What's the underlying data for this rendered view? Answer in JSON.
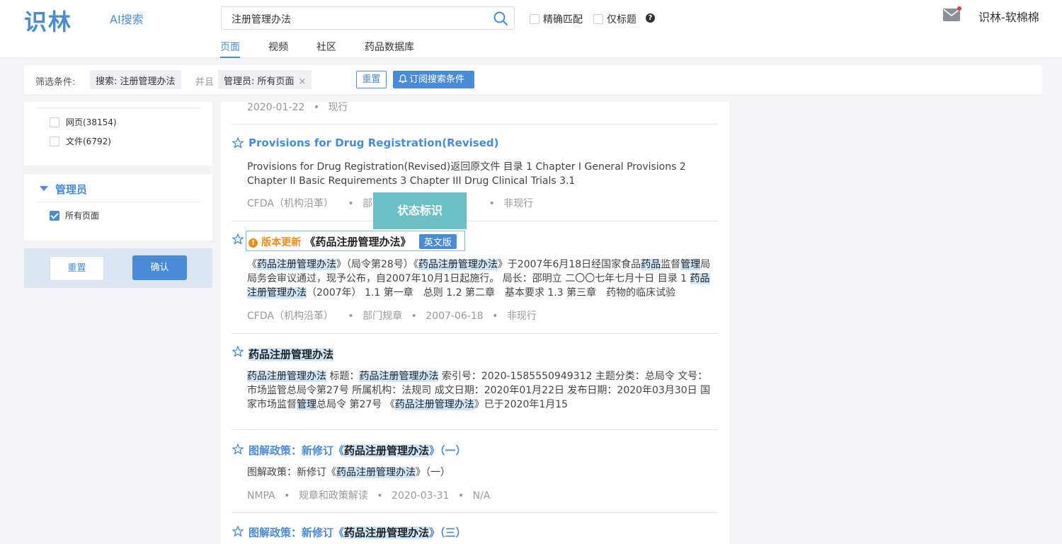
{
  "header": {
    "logo": "识林",
    "ai_search": "AI搜索",
    "search_value": "注册管理办法",
    "exact_match_label": "精确匹配",
    "title_only_label": "仅标题",
    "help_glyph": "?",
    "tabs": [
      {
        "label": "页面",
        "active": true
      },
      {
        "label": "视频",
        "active": false
      },
      {
        "label": "社区",
        "active": false
      },
      {
        "label": "药品数据库",
        "active": false
      }
    ],
    "user_name": "识林-软棉棉"
  },
  "filter_bar": {
    "label": "筛选条件:",
    "chip_search": "搜索: 注册管理办法",
    "and": "并且",
    "chip_admin": "管理员: 所有页面",
    "chip_close": "×",
    "reset_label": "重置",
    "subscribe_label": "订阅搜索条件"
  },
  "sidebar": {
    "types": [
      {
        "label": "网页(38154)"
      },
      {
        "label": "文件(6792)"
      }
    ],
    "admin_title": "管理员",
    "admin_option": "所有页面",
    "reset_label": "重置",
    "confirm_label": "确认"
  },
  "results": {
    "top_meta": {
      "date": "2020-01-22",
      "status": "现行"
    },
    "item1": {
      "title": "Provisions for Drug Registration(Revised)",
      "snippet": "Provisions for Drug Registration(Revised)返回原文件 目录 1 Chapter I General Provisions 2 Chapter II Basic Requirements 3 Chapter III Drug Clinical Trials 3.1",
      "meta_source": "CFDA（机构沿革）",
      "meta_type": "部门规",
      "meta_status": "非现行"
    },
    "item2": {
      "status_label": "版本更新",
      "title": "《药品注册管理办法》",
      "en_badge": "英文版",
      "snippet_parts": {
        "p1": "《",
        "h1": "药品注册管理办法",
        "p2": "》（局令第28号）《",
        "h2": "药品注册管理办法",
        "p3": "》于2007年6月18日经国家食品",
        "h3": "药品",
        "p4": "监督",
        "h4": "管理",
        "p5": "局局务会审议通过，现予公布，自2007年10月1日起施行。 局长：邵明立 二〇〇七年七月十日 目录 1 ",
        "h5": "药品注册管理办法",
        "p6": "（2007年） 1.1 第一章　总则 1.2 第二章　基本要求 1.3 第三章　药物的临床试验"
      },
      "meta_source": "CFDA（机构沿革）",
      "meta_type": "部门规章",
      "meta_date": "2007-06-18",
      "meta_status": "非现行"
    },
    "item3": {
      "title": "药品注册管理办法",
      "snippet_parts": {
        "h1": "药品注册管理办法",
        "p1": " 标题：",
        "h2": "药品注册管理办法",
        "p2": " 索引号：2020-1585550949312 主题分类：总局令 文号：市场监管总局令第27号 所属机构：法规司 成文日期：2020年01月22日 发布日期：2020年03月30日 国家市场监督",
        "h3": "管理",
        "p3": "总局令 第27号 《",
        "h4": "药品注册管理办法",
        "p4": "》已于2020年1月15"
      }
    },
    "item4": {
      "title_prefix": "图解政策：新修订《",
      "title_hl": "药品注册管理办法",
      "title_suffix": "》（一）",
      "snippet_prefix": "图解政策：新修订《",
      "snippet_hl": "药品注册管理办法",
      "snippet_suffix": "》（一）",
      "meta_source": "NMPA",
      "meta_type": "规章和政策解读",
      "meta_date": "2020-03-31",
      "meta_status": "N/A"
    },
    "item5": {
      "title_prefix": "图解政策：新修订《",
      "title_hl": "药品注册管理办法",
      "title_suffix": "》（三）"
    }
  },
  "tooltip": "状态标识",
  "meta_dot": "•",
  "icons": {
    "search": "search-icon",
    "mail": "mail-icon",
    "help": "help-icon",
    "bell": "bell-icon",
    "star": "star-icon",
    "warning": "warning-icon",
    "caret": "caret-down-icon"
  },
  "colors": {
    "accent": "#4a8bd6",
    "warning": "#f08c1e",
    "tooltip": "#6cbfc3",
    "highlight": "#cfe6f8"
  }
}
